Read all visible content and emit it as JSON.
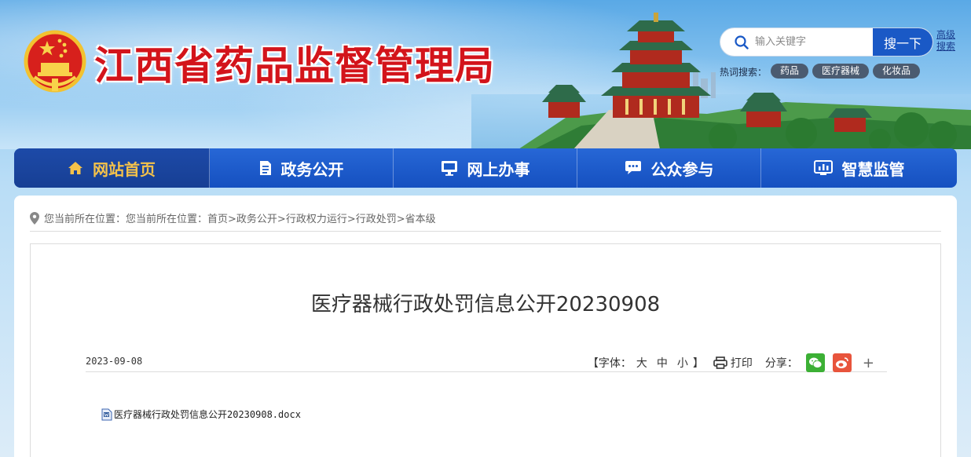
{
  "header": {
    "site_title": "江西省药品监督管理局",
    "search": {
      "placeholder": "输入关键字",
      "button_label": "搜一下",
      "advanced_label": "高级搜索"
    },
    "hot_search": {
      "label": "热词搜索：",
      "tags": [
        "药品",
        "医疗器械",
        "化妆品"
      ]
    }
  },
  "nav": {
    "items": [
      {
        "label": "网站首页",
        "icon": "home-icon",
        "active": true
      },
      {
        "label": "政务公开",
        "icon": "document-icon",
        "active": false
      },
      {
        "label": "网上办事",
        "icon": "monitor-icon",
        "active": false
      },
      {
        "label": "公众参与",
        "icon": "chat-icon",
        "active": false
      },
      {
        "label": "智慧监管",
        "icon": "dashboard-icon",
        "active": false
      }
    ]
  },
  "breadcrumb": {
    "prefix": "您当前所在位置：",
    "label_repeat": "您当前所在位置：",
    "path": "首页>政务公开>行政权力运行>行政处罚>省本级"
  },
  "article": {
    "title": "医疗器械行政处罚信息公开20230908",
    "date": "2023-09-08",
    "font_size_label_open": "【字体：",
    "font_sizes": [
      "大",
      "中",
      "小"
    ],
    "font_size_label_close": "】",
    "print_label": "打印",
    "share_label": "分享：",
    "share_more": "+",
    "attachment": "医疗器械行政处罚信息公开20230908.docx"
  },
  "colors": {
    "title_red": "#d3141b",
    "nav_blue": "#1a59c6",
    "nav_active_text": "#f5c24a",
    "wechat_green": "#3cb035",
    "weibo_red": "#e8543c"
  }
}
